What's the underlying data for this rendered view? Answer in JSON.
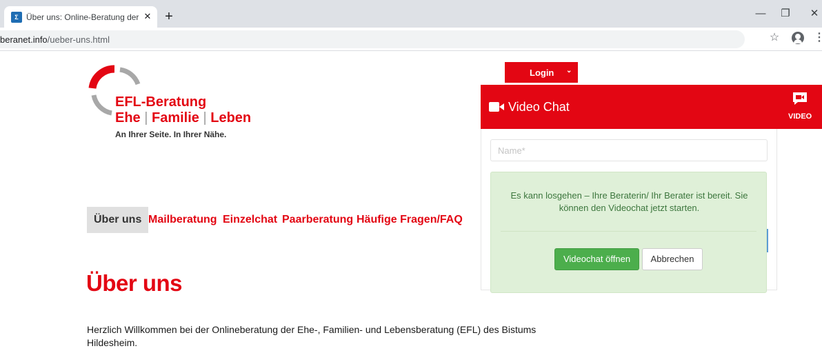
{
  "browser": {
    "tab_title": "Über uns: Online-Beratung der Ehe-, Familien- und Lebensberatung",
    "favicon_text": "Σ",
    "close_tab_glyph": "✕",
    "new_tab_glyph": "+",
    "url_domain": "beranet.info",
    "url_path": "/ueber-uns.html",
    "window_buttons": {
      "minimize": "—",
      "maximize": "❐",
      "close": "✕"
    },
    "star_glyph": "☆",
    "menu_glyph": "⋮"
  },
  "site": {
    "logo": {
      "title": "EFL-Beratung",
      "line2_part1": "Ehe",
      "line2_sep1": " | ",
      "line2_part2": "Familie",
      "line2_sep2": " | ",
      "line2_part3": "Leben",
      "tagline": "An Ihrer Seite. In Ihrer Nähe.",
      "colors": {
        "red": "#e30613",
        "grey": "#a8a8a8"
      }
    },
    "login": {
      "label": "Login",
      "caret": "⌄"
    },
    "nav": [
      {
        "label": "Über uns",
        "active": true
      },
      {
        "label": "Mailberatung",
        "active": false
      },
      {
        "label": "Einzelchat",
        "active": false
      },
      {
        "label": "Paarberatung",
        "active": false
      },
      {
        "label": "Häufige Fragen/FAQ",
        "active": false
      }
    ],
    "heading": "Über uns",
    "intro": "Herzlich Willkommen bei der Onlineberatung der Ehe-, Familien- und Lebensberatung (EFL) des Bistums Hildesheim."
  },
  "video_chat": {
    "title": "Video Chat",
    "side_label": "VIDEO",
    "name_placeholder": "Name*",
    "name_value": "",
    "alert_text": "Es kann losgehen – Ihre Beraterin/ Ihr Berater ist bereit. Sie können den Videochat jetzt starten.",
    "open_button": "Videochat öffnen",
    "cancel_button": "Abbrechen",
    "colors": {
      "header": "#e30613",
      "alert_bg": "#dff0d8",
      "primary_button": "#4cae4c"
    }
  }
}
